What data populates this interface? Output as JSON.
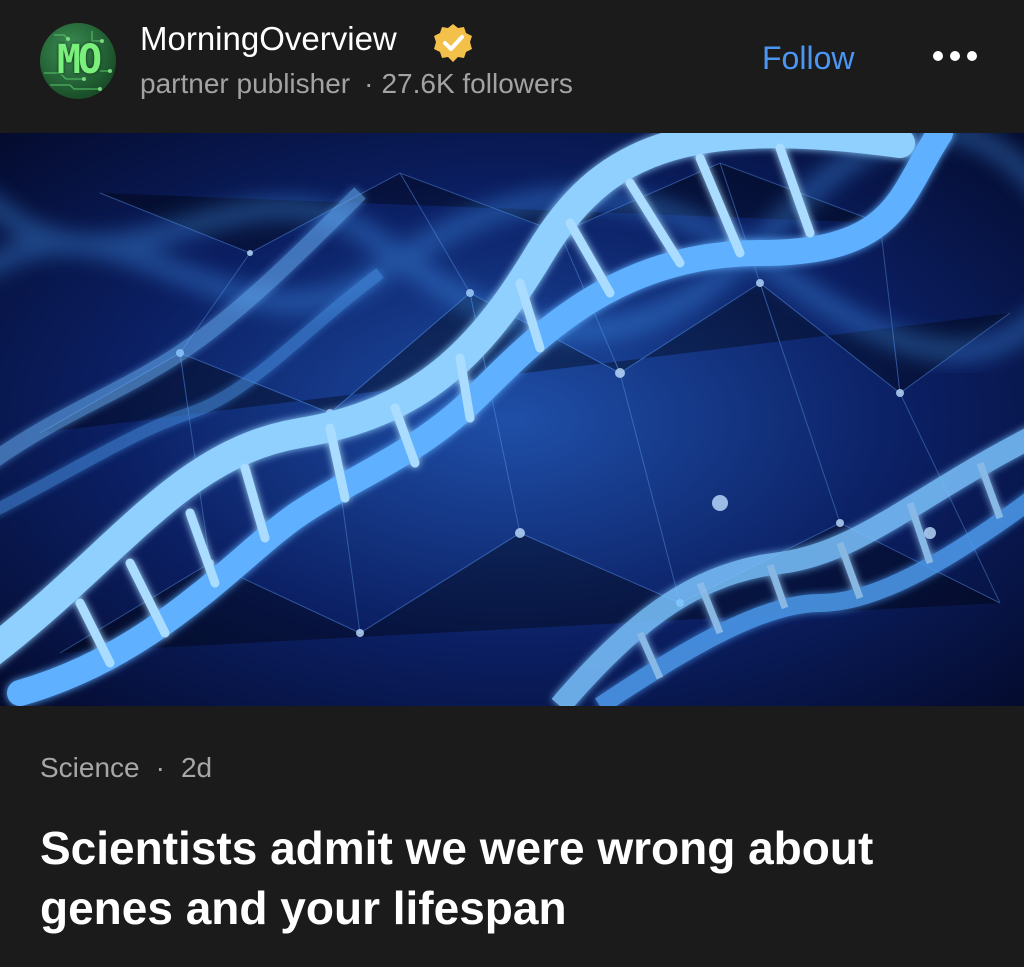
{
  "publisher": {
    "avatar_initials": "MO",
    "name": "MorningOverview",
    "role": "partner publisher",
    "followers": "27.6K followers",
    "verified_icon": "verified-badge-icon"
  },
  "actions": {
    "follow_label": "Follow",
    "more_icon": "more-horizontal-icon"
  },
  "article": {
    "image_subject": "dna-helix-image",
    "category": "Science",
    "separator": "·",
    "age": "2d",
    "title": "Scientists admit we were wrong about genes and your lifespan"
  },
  "colors": {
    "background": "#1b1b1b",
    "accent": "#4b96f5",
    "muted_text": "#a3a3a3",
    "verified_badge": "#f3c04a"
  }
}
